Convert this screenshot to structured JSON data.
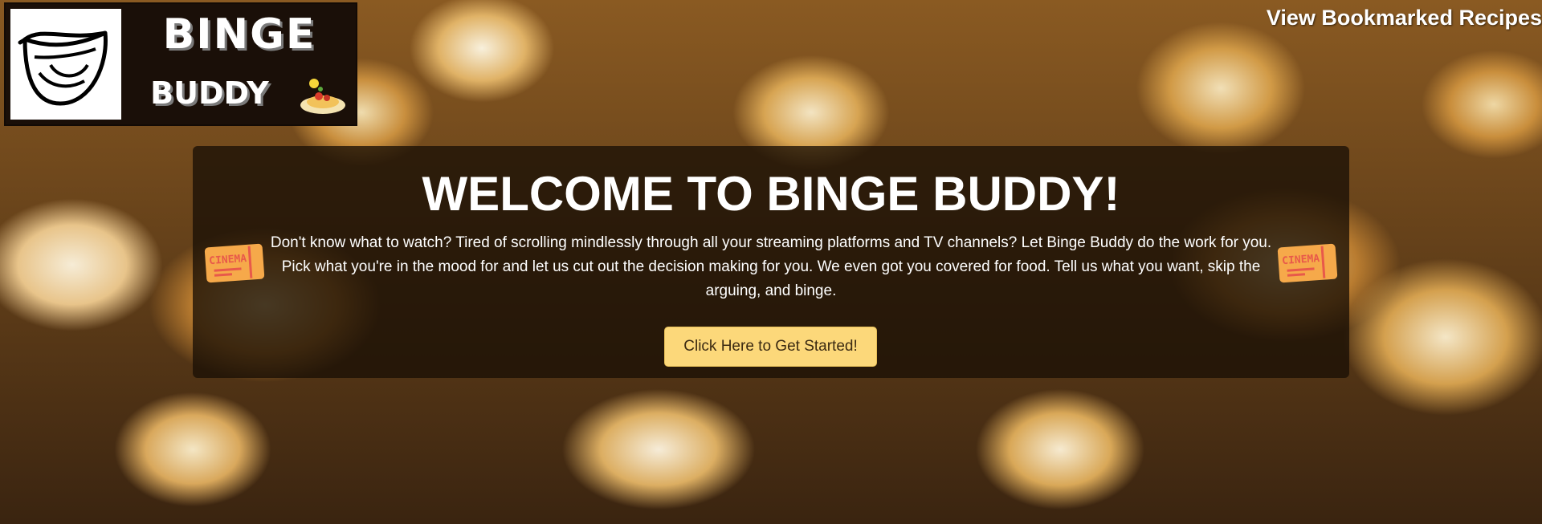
{
  "header": {
    "logo": {
      "word_top": "BINGE",
      "word_bottom": "BUDDY",
      "mouth_icon": "mouth-icon",
      "food_icon": "spaghetti-plate-icon"
    },
    "nav_link_label": "View Bookmarked Recipes"
  },
  "hero": {
    "title": "WELCOME TO BINGE BUDDY!",
    "description": "Don't know what to watch? Tired of scrolling mindlessly through all your streaming platforms and TV channels? Let Binge Buddy do the work for you. Pick what you're in the mood for and let us cut out the decision making for you. We even got you covered for food. Tell us what you want, skip the arguing, and binge.",
    "ticket_text": "CINEMA",
    "ticket_icon": "cinema-ticket-icon",
    "cta_label": "Click Here to Get Started!"
  },
  "colors": {
    "cta_background": "#fcd87a",
    "hero_background": "rgba(25,15,5,0.78)",
    "ticket_orange": "#f6a94a",
    "ticket_red": "#e8594a"
  }
}
